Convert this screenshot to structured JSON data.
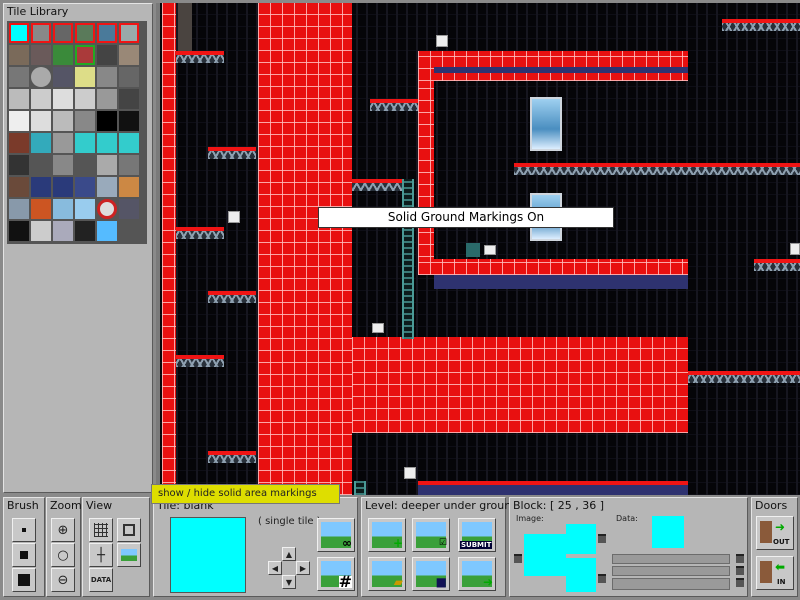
{
  "tile_library": {
    "title": "Tile Library"
  },
  "canvas": {
    "toast": "Solid Ground Markings On"
  },
  "tooltip": "show / hide solid area markings",
  "brush": {
    "title": "Brush"
  },
  "zoom": {
    "title": "Zoom"
  },
  "view": {
    "title": "View",
    "data_label": "DATA"
  },
  "tile_panel": {
    "title": "Tile: blank",
    "mode": "( single tile )"
  },
  "level": {
    "title": "Level: deeper under ground",
    "submit_label": "SUBMIT"
  },
  "block": {
    "title": "Block: [ 25 , 36 ]",
    "image_label": "Image:",
    "data_label": "Data:"
  },
  "doors": {
    "title": "Doors",
    "out_label": "OUT",
    "in_label": "IN"
  },
  "colors": {
    "solid_marking": "#f01414",
    "selection": "#00ffff",
    "tooltip_bg": "#dede00"
  }
}
